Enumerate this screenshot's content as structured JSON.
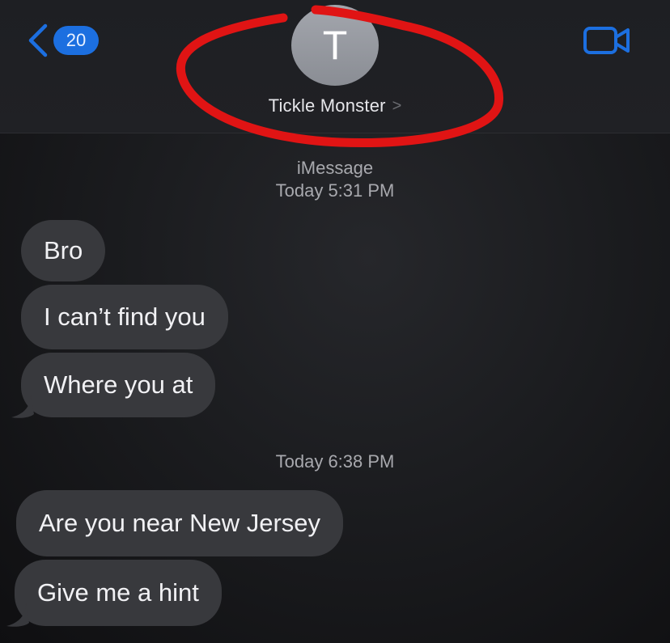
{
  "header": {
    "back_count": "20",
    "avatar_initial": "T",
    "contact_name": "Tickle Monster",
    "contact_chevron": ">"
  },
  "colors": {
    "accent": "#1c6fe0",
    "bubble": "#38393d",
    "highlight_circle": "#e01414"
  },
  "icons": {
    "back": "chevron-left-icon",
    "video": "video-camera-icon",
    "disclosure": "chevron-right-icon"
  },
  "thread": {
    "service_label": "iMessage",
    "timestamp_1": "Today 5:31 PM",
    "timestamp_2": "Today 6:38 PM",
    "messages_group_1": [
      "Bro",
      "I can’t find you",
      "Where you at"
    ],
    "messages_group_2": [
      "Are you near New Jersey",
      "Give me a hint"
    ]
  }
}
